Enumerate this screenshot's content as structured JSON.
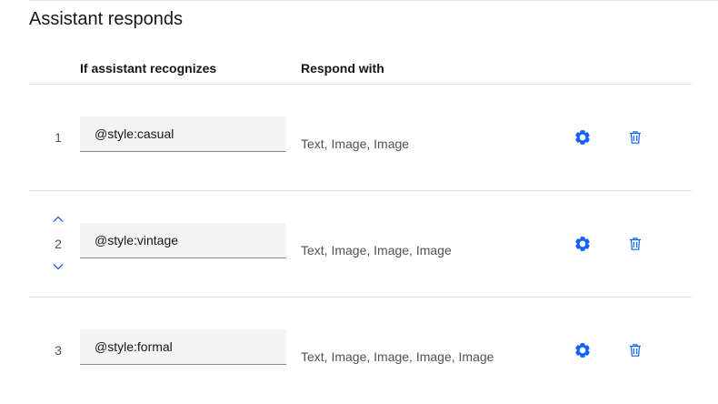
{
  "section": {
    "title": "Assistant responds"
  },
  "columns": {
    "condition_header": "If assistant recognizes",
    "response_header": "Respond with"
  },
  "rows": [
    {
      "number": "1",
      "condition": "@style:casual",
      "responses": "Text, Image, Image"
    },
    {
      "number": "2",
      "condition": "@style:vintage",
      "responses": "Text, Image, Image, Image"
    },
    {
      "number": "3",
      "condition": "@style:formal",
      "responses": "Text, Image, Image, Image, Image"
    }
  ],
  "icons": {
    "gear": "gear-icon",
    "trash": "trash-icon",
    "move_up": "chevron-up-icon",
    "move_down": "chevron-down-icon"
  },
  "colors": {
    "accent": "#0f62fe",
    "field_bg": "#f4f4f4",
    "divider": "#e0e0e0"
  }
}
